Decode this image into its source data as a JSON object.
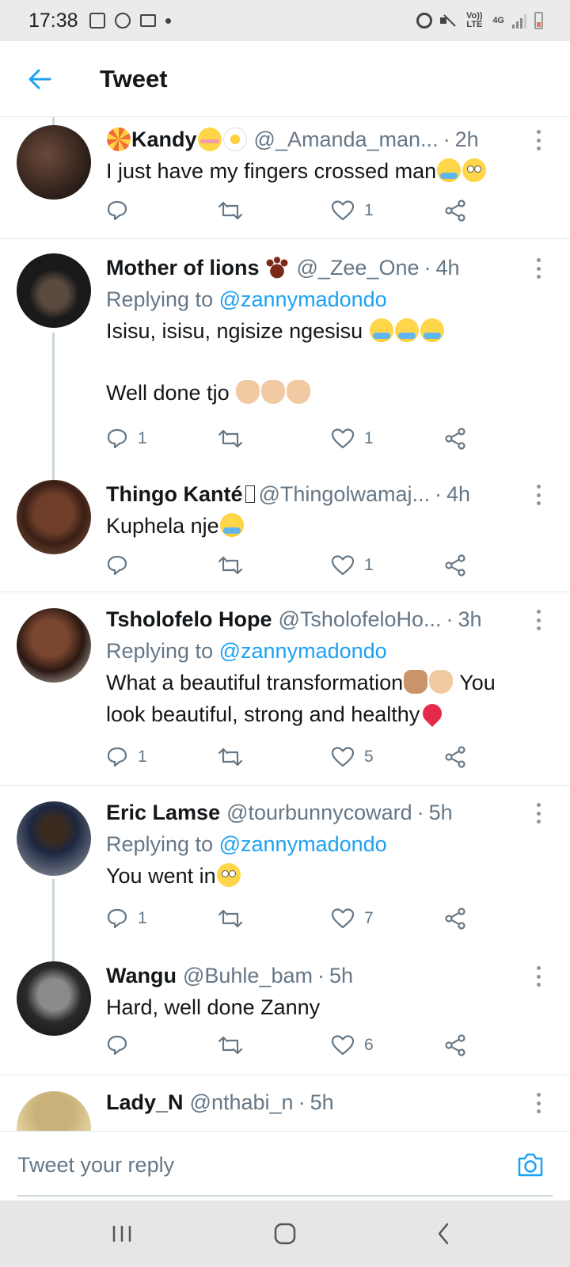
{
  "status_bar": {
    "time": "17:38",
    "left_icons": [
      "gallery-icon",
      "sync-icon",
      "gmail-icon",
      "dot-icon"
    ],
    "right_icons": [
      "alarm-icon",
      "mute-icon",
      "volte-icon",
      "4g-icon",
      "signal-icon",
      "battery-icon"
    ],
    "volte_label": "Vo)) LTE",
    "network_label": "4G"
  },
  "header": {
    "title": "Tweet",
    "accent_color": "#1da1f2"
  },
  "tweets": [
    {
      "name": "Kandy",
      "name_emojis_before": [
        "lollipop"
      ],
      "name_emojis_after": [
        "smiling-blush",
        "flower"
      ],
      "handle": "@_Amanda_man...",
      "separator": "·",
      "time": "2h",
      "replying_to": null,
      "text_lines": [
        "I just have my fingers crossed man"
      ],
      "reply_count": "",
      "retweet_count": "",
      "like_count": "1"
    },
    {
      "name": "Mother of lions",
      "name_emojis_after": [
        "paw-prints"
      ],
      "handle": "@_Zee_One",
      "separator": "·",
      "time": "4h",
      "replying_label": "Replying to",
      "replying_to": "@zannymadondo",
      "text_lines": [
        "Isisu, isisu, ngisize ngesisu",
        "Well done tjo"
      ],
      "reply_count": "1",
      "retweet_count": "",
      "like_count": "1"
    },
    {
      "name": "Thingo Kanté",
      "handle": "@Thingolwamaj...",
      "separator": "·",
      "time": "4h",
      "replying_to": null,
      "text_lines": [
        "Kuphela nje"
      ],
      "reply_count": "",
      "retweet_count": "",
      "like_count": "1"
    },
    {
      "name": "Tsholofelo Hope",
      "handle": "@TsholofeloHo...",
      "separator": "·",
      "time": "3h",
      "replying_label": "Replying to",
      "replying_to": "@zannymadondo",
      "text_lines": [
        "What a beautiful transformation",
        "You",
        "look beautiful, strong and healthy"
      ],
      "reply_count": "1",
      "retweet_count": "",
      "like_count": "5"
    },
    {
      "name": "Eric Lamse",
      "handle": "@tourbunnycoward",
      "separator": "·",
      "time": "5h",
      "replying_label": "Replying to",
      "replying_to": "@zannymadondo",
      "text_lines": [
        "You went in"
      ],
      "reply_count": "1",
      "retweet_count": "",
      "like_count": "7"
    },
    {
      "name": "Wangu",
      "handle": "@Buhle_bam",
      "separator": "·",
      "time": "5h",
      "replying_to": null,
      "text_lines": [
        "Hard, well done Zanny"
      ],
      "reply_count": "",
      "retweet_count": "",
      "like_count": "6"
    },
    {
      "name": "Lady_N",
      "handle": "@nthabi_n",
      "separator": "·",
      "time": "5h"
    }
  ],
  "reply_box": {
    "placeholder": "Tweet your reply"
  },
  "nav_bar": {
    "buttons": [
      "recents-icon",
      "home-icon",
      "back-nav-icon"
    ]
  }
}
